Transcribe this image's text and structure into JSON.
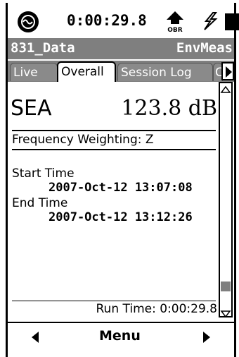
{
  "status": {
    "time": "0:00:29.8",
    "indicator_label": "OBR",
    "icons": [
      "meter-logo-icon",
      "overload-indicator-icon",
      "power-icon",
      "battery-icon"
    ]
  },
  "titlebar": {
    "file": "831_Data",
    "mode": "EnvMeas"
  },
  "tabs": [
    {
      "label": "Live",
      "active": false
    },
    {
      "label": "Overall",
      "active": true
    },
    {
      "label": "Session Log",
      "active": false
    },
    {
      "label": "C",
      "active": false
    }
  ],
  "main": {
    "metric_label": "SEA",
    "metric_value": "123.8 dB",
    "frequency_weighting": "Frequency Weighting: Z",
    "start_label": "Start Time",
    "start_value": "2007-Oct-12 13:07:08",
    "end_label": "End Time",
    "end_value": "2007-Oct-12 13:12:26",
    "run_time": "Run Time:  0:00:29.8"
  },
  "scrollbar": {
    "position": 0.92
  },
  "bottom": {
    "menu_label": "Menu"
  },
  "colors": {
    "bar": "#7f7f7f",
    "text": "#000000",
    "background": "#ffffff"
  }
}
